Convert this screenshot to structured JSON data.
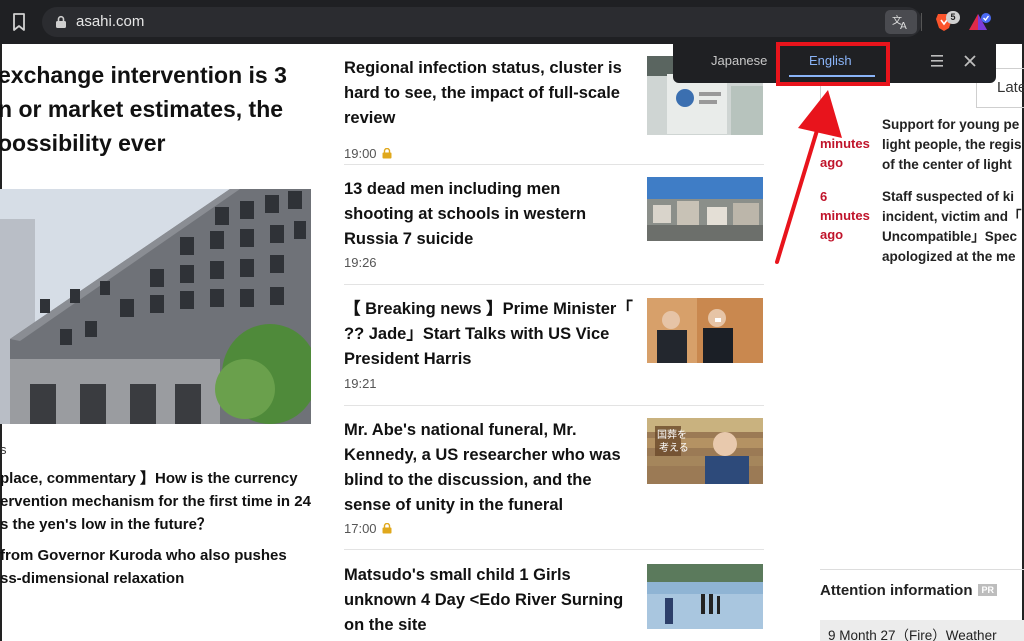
{
  "browser": {
    "url": "asahi.com",
    "brave_shields_count": "5"
  },
  "translate_popup": {
    "source_tab": "Japanese",
    "target_tab": "English",
    "selected": "English"
  },
  "lead_story": {
    "title_lines": [
      "exchange intervention is 3",
      "n or market estimates, the",
      "oossibility ever"
    ],
    "bullet": "s",
    "sub_lines": [
      "place, commentary 】How is the currency",
      "ervention mechanism for the first time in 24",
      "s the yen's low in the future？"
    ],
    "related_lines": [
      "from Governor Kuroda who also pushes",
      "ss-dimensional relaxation"
    ]
  },
  "news": [
    {
      "title": "Regional infection status, cluster is hard to see, the impact of full-scale review",
      "time": "19:00",
      "locked": true
    },
    {
      "title": "13 dead men including men shooting at schools in western Russia 7 suicide",
      "time": "19:26",
      "locked": false
    },
    {
      "title": "【 Breaking news 】Prime Minister「 ?? Jade」Start Talks with US Vice President Harris",
      "time": "19:21",
      "locked": false
    },
    {
      "title": "Mr. Abe's national funeral, Mr. Kennedy, a US researcher who was blind to the discussion, and the sense of unity in the funeral",
      "time": "17:00",
      "locked": true
    },
    {
      "title": "Matsudo's small child 1 Girls unknown 4 Day <Edo River Surning on the site",
      "time": "",
      "locked": false
    }
  ],
  "thumb_caption": "国葬を\n考える",
  "sidebar": {
    "tab_label": "Late",
    "rankings": [
      {
        "time": "minutes ago",
        "lines": [
          "Support for young pe",
          "light people, the regis",
          "of the center of light"
        ]
      },
      {
        "time": "6 minutes ago",
        "lines": [
          "Staff suspected of ki",
          "incident, victim and「",
          "Uncompatible」Spec",
          "apologized at the me"
        ]
      }
    ],
    "attention_title": "Attention information",
    "pr_label": "PR",
    "weather": "9 Month 27（Fire）Weather"
  },
  "colors": {
    "annotation": "#e8141c",
    "accent_blue": "#8ab4f8",
    "ranking_time": "#c0142b"
  },
  "icons": [
    "bookmark-icon",
    "lock-icon",
    "translate-icon",
    "brave-lion-icon",
    "brave-rewards-icon",
    "menu-icon",
    "close-icon",
    "padlock-badge-icon"
  ]
}
